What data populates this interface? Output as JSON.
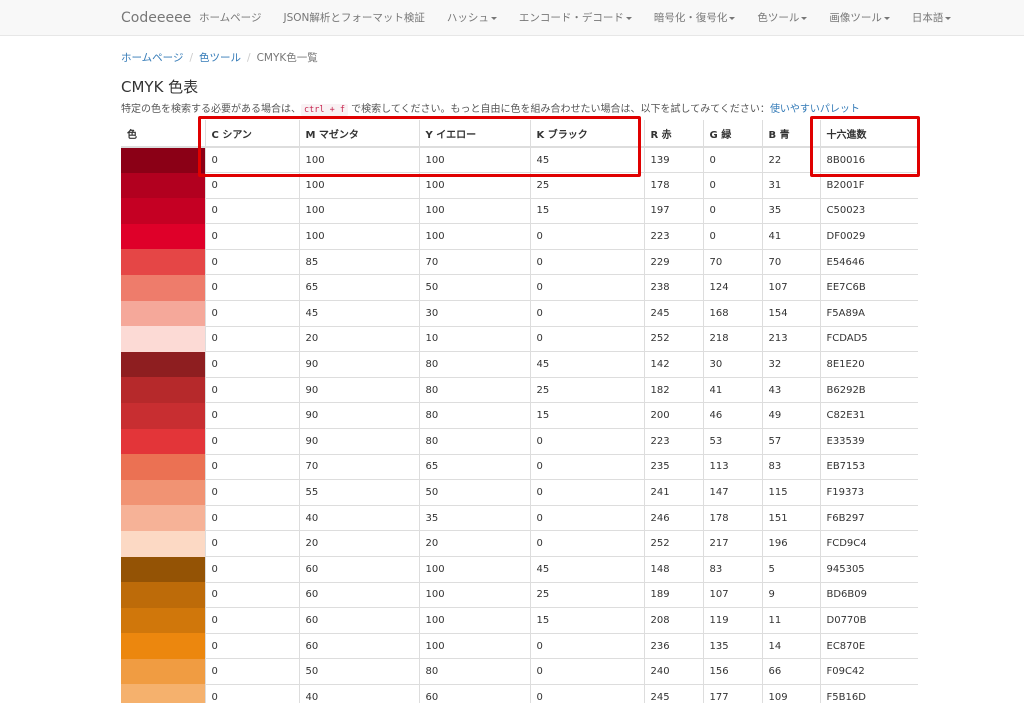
{
  "navbar": {
    "brand": "Codeeeee",
    "items": [
      {
        "label": "ホームページ",
        "dropdown": false
      },
      {
        "label": "JSON解析とフォーマット検証",
        "dropdown": false
      },
      {
        "label": "ハッシュ",
        "dropdown": true
      },
      {
        "label": "エンコード・デコード",
        "dropdown": true
      },
      {
        "label": "暗号化・復号化",
        "dropdown": true
      },
      {
        "label": "色ツール",
        "dropdown": true
      },
      {
        "label": "画像ツール",
        "dropdown": true
      },
      {
        "label": "日本語",
        "dropdown": true
      }
    ]
  },
  "breadcrumb": {
    "home": "ホームページ",
    "tools": "色ツール",
    "current": "CMYK色一覧",
    "separator": "/"
  },
  "page": {
    "title": "CMYK 色表",
    "desc_before": "特定の色を検索する必要がある場合は、",
    "kbd": "ctrl + f",
    "desc_after": " で検索してください。もっと自由に色を組み合わせたい場合は、以下を試してみてください：",
    "link": "使いやすいパレット"
  },
  "table": {
    "headers": [
      "色",
      "C シアン",
      "M マゼンタ",
      "Y イエロー",
      "K ブラック",
      "R 赤",
      "G 緑",
      "B 青",
      "十六進数"
    ],
    "rows": [
      {
        "c": "0",
        "m": "100",
        "y": "100",
        "k": "45",
        "r": "139",
        "g": "0",
        "b": "22",
        "hex": "8B0016"
      },
      {
        "c": "0",
        "m": "100",
        "y": "100",
        "k": "25",
        "r": "178",
        "g": "0",
        "b": "31",
        "hex": "B2001F"
      },
      {
        "c": "0",
        "m": "100",
        "y": "100",
        "k": "15",
        "r": "197",
        "g": "0",
        "b": "35",
        "hex": "C50023"
      },
      {
        "c": "0",
        "m": "100",
        "y": "100",
        "k": "0",
        "r": "223",
        "g": "0",
        "b": "41",
        "hex": "DF0029"
      },
      {
        "c": "0",
        "m": "85",
        "y": "70",
        "k": "0",
        "r": "229",
        "g": "70",
        "b": "70",
        "hex": "E54646"
      },
      {
        "c": "0",
        "m": "65",
        "y": "50",
        "k": "0",
        "r": "238",
        "g": "124",
        "b": "107",
        "hex": "EE7C6B"
      },
      {
        "c": "0",
        "m": "45",
        "y": "30",
        "k": "0",
        "r": "245",
        "g": "168",
        "b": "154",
        "hex": "F5A89A"
      },
      {
        "c": "0",
        "m": "20",
        "y": "10",
        "k": "0",
        "r": "252",
        "g": "218",
        "b": "213",
        "hex": "FCDAD5"
      },
      {
        "c": "0",
        "m": "90",
        "y": "80",
        "k": "45",
        "r": "142",
        "g": "30",
        "b": "32",
        "hex": "8E1E20"
      },
      {
        "c": "0",
        "m": "90",
        "y": "80",
        "k": "25",
        "r": "182",
        "g": "41",
        "b": "43",
        "hex": "B6292B"
      },
      {
        "c": "0",
        "m": "90",
        "y": "80",
        "k": "15",
        "r": "200",
        "g": "46",
        "b": "49",
        "hex": "C82E31"
      },
      {
        "c": "0",
        "m": "90",
        "y": "80",
        "k": "0",
        "r": "223",
        "g": "53",
        "b": "57",
        "hex": "E33539"
      },
      {
        "c": "0",
        "m": "70",
        "y": "65",
        "k": "0",
        "r": "235",
        "g": "113",
        "b": "83",
        "hex": "EB7153"
      },
      {
        "c": "0",
        "m": "55",
        "y": "50",
        "k": "0",
        "r": "241",
        "g": "147",
        "b": "115",
        "hex": "F19373"
      },
      {
        "c": "0",
        "m": "40",
        "y": "35",
        "k": "0",
        "r": "246",
        "g": "178",
        "b": "151",
        "hex": "F6B297"
      },
      {
        "c": "0",
        "m": "20",
        "y": "20",
        "k": "0",
        "r": "252",
        "g": "217",
        "b": "196",
        "hex": "FCD9C4"
      },
      {
        "c": "0",
        "m": "60",
        "y": "100",
        "k": "45",
        "r": "148",
        "g": "83",
        "b": "5",
        "hex": "945305"
      },
      {
        "c": "0",
        "m": "60",
        "y": "100",
        "k": "25",
        "r": "189",
        "g": "107",
        "b": "9",
        "hex": "BD6B09"
      },
      {
        "c": "0",
        "m": "60",
        "y": "100",
        "k": "15",
        "r": "208",
        "g": "119",
        "b": "11",
        "hex": "D0770B"
      },
      {
        "c": "0",
        "m": "60",
        "y": "100",
        "k": "0",
        "r": "236",
        "g": "135",
        "b": "14",
        "hex": "EC870E"
      },
      {
        "c": "0",
        "m": "50",
        "y": "80",
        "k": "0",
        "r": "240",
        "g": "156",
        "b": "66",
        "hex": "F09C42"
      },
      {
        "c": "0",
        "m": "40",
        "y": "60",
        "k": "0",
        "r": "245",
        "g": "177",
        "b": "109",
        "hex": "F5B16D"
      }
    ]
  },
  "colors": {
    "highlight": "#e00000",
    "link": "#337ab7"
  }
}
